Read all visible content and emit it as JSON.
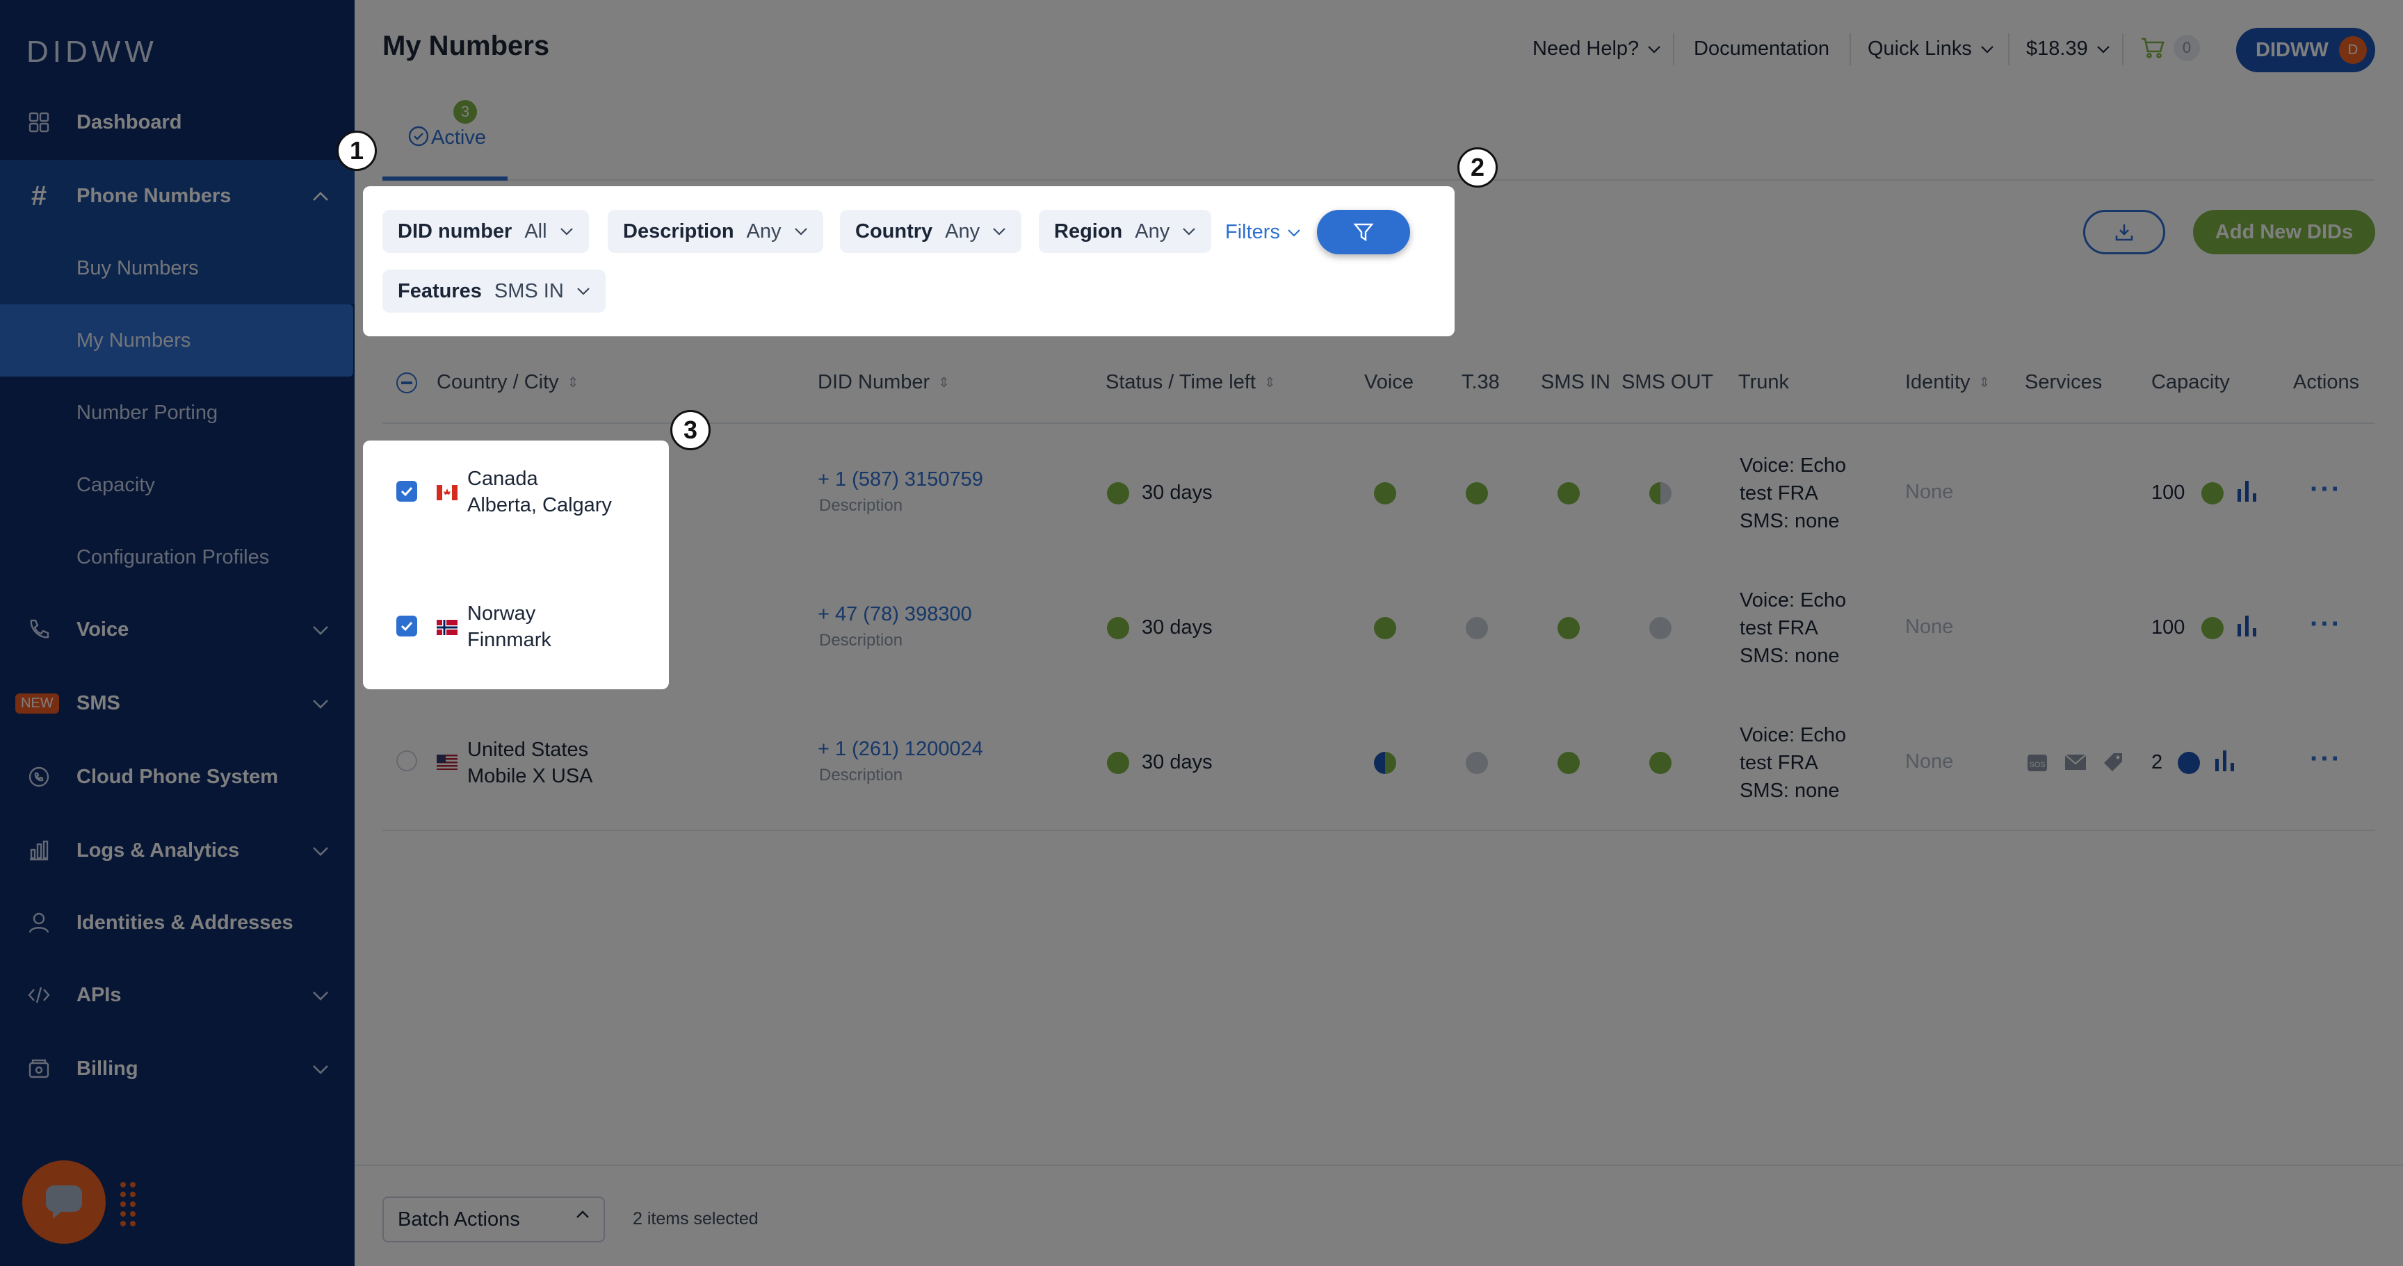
{
  "brand": "DIDWW",
  "sidebar": {
    "items": [
      {
        "label": "Dashboard"
      },
      {
        "label": "Phone Numbers"
      },
      {
        "label": "Buy Numbers"
      },
      {
        "label": "My Numbers"
      },
      {
        "label": "Number Porting"
      },
      {
        "label": "Capacity"
      },
      {
        "label": "Configuration Profiles"
      },
      {
        "label": "Voice"
      },
      {
        "label": "SMS",
        "badge": "NEW"
      },
      {
        "label": "Cloud Phone System"
      },
      {
        "label": "Logs & Analytics"
      },
      {
        "label": "Identities & Addresses"
      },
      {
        "label": "APIs"
      },
      {
        "label": "Billing"
      }
    ]
  },
  "header": {
    "title": "My Numbers",
    "need_help": "Need Help?",
    "documentation": "Documentation",
    "quick_links": "Quick Links",
    "balance": "$18.39",
    "cart_count": "0",
    "user": "DIDWW",
    "user_initial": "D"
  },
  "tabs": [
    {
      "label": "Active",
      "count": "3"
    }
  ],
  "filters": {
    "did": {
      "key": "DID number",
      "value": "All"
    },
    "description": {
      "key": "Description",
      "value": "Any"
    },
    "country": {
      "key": "Country",
      "value": "Any"
    },
    "region": {
      "key": "Region",
      "value": "Any"
    },
    "features": {
      "key": "Features",
      "value": "SMS IN"
    },
    "filters_link": "Filters"
  },
  "actions": {
    "add": "Add New DIDs"
  },
  "table": {
    "columns": [
      "Country / City",
      "DID Number",
      "Status / Time left",
      "Voice",
      "T.38",
      "SMS IN",
      "SMS OUT",
      "Trunk",
      "Identity",
      "Services",
      "Capacity",
      "Actions"
    ],
    "rows": [
      {
        "country": "Canada",
        "city": "Alberta, Calgary",
        "did": "+ 1 (587) 3150759",
        "desc": "Description",
        "status": "30 days",
        "trunk1": "Voice: Echo",
        "trunk2": "test FRA",
        "trunk3": "SMS: none",
        "identity": "None",
        "capacity": "100"
      },
      {
        "country": "Norway",
        "city": "Finnmark",
        "did": "+ 47 (78) 398300",
        "desc": "Description",
        "status": "30 days",
        "trunk1": "Voice: Echo",
        "trunk2": "test FRA",
        "trunk3": "SMS: none",
        "identity": "None",
        "capacity": "100"
      },
      {
        "country": "United States",
        "city": "Mobile X USA",
        "did": "+ 1 (261) 1200024",
        "desc": "Description",
        "status": "30 days",
        "trunk1": "Voice: Echo",
        "trunk2": "test FRA",
        "trunk3": "SMS: none",
        "identity": "None",
        "capacity": "2"
      }
    ]
  },
  "footer": {
    "batch": "Batch Actions",
    "selected": "2 items selected"
  },
  "markers": [
    "1",
    "2",
    "3"
  ],
  "colors": {
    "sidebar": "#0f2d6b",
    "accent": "#2c6fd1",
    "green": "#7cb342",
    "orange": "#f26522"
  }
}
